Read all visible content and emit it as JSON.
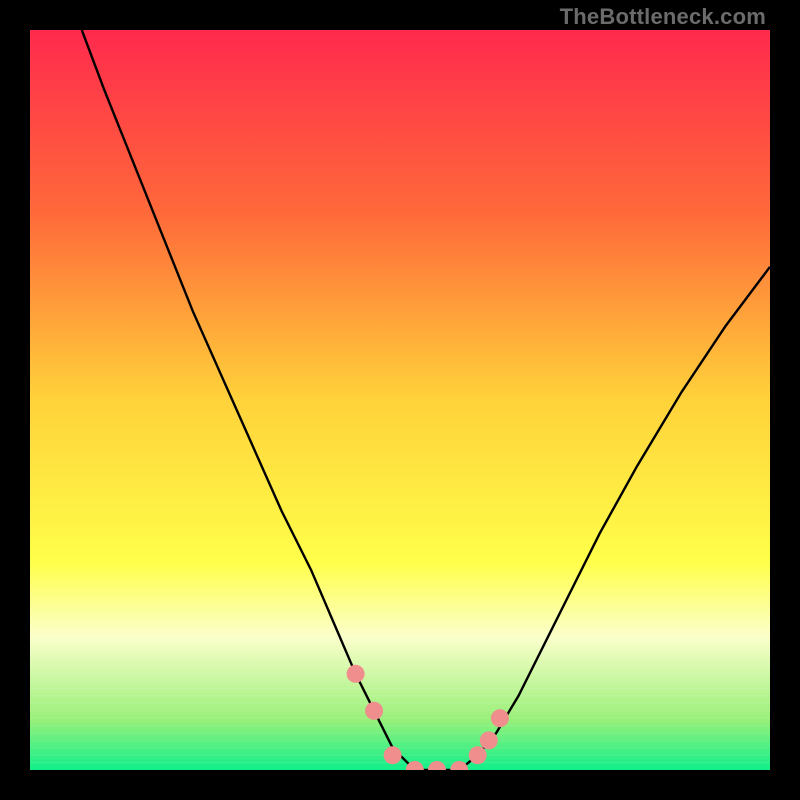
{
  "watermark": "TheBottleneck.com",
  "chart_data": {
    "type": "line",
    "title": "",
    "xlabel": "",
    "ylabel": "",
    "xlim": [
      0,
      100
    ],
    "ylim": [
      0,
      100
    ],
    "grid": false,
    "legend": false,
    "background_gradient": {
      "direction": "top-to-bottom",
      "stops": [
        {
          "pos": 0.0,
          "color": "#ff2a4d"
        },
        {
          "pos": 0.25,
          "color": "#ff6a3a"
        },
        {
          "pos": 0.5,
          "color": "#ffd23a"
        },
        {
          "pos": 0.72,
          "color": "#ffff4a"
        },
        {
          "pos": 0.82,
          "color": "#fbffcb"
        },
        {
          "pos": 0.93,
          "color": "#9bf07a"
        },
        {
          "pos": 1.0,
          "color": "#10ef8a"
        }
      ]
    },
    "series": [
      {
        "name": "bottleneck-curve",
        "type": "line",
        "color": "#000000",
        "x": [
          7,
          10,
          14,
          18,
          22,
          26,
          30,
          34,
          38,
          41,
          44,
          46.5,
          49,
          52,
          55,
          58,
          60.5,
          63,
          66,
          69,
          73,
          77,
          82,
          88,
          94,
          100
        ],
        "y": [
          100,
          92,
          82,
          72,
          62,
          53,
          44,
          35,
          27,
          20,
          13,
          8,
          3,
          0,
          0,
          0,
          2,
          5,
          10,
          16,
          24,
          32,
          41,
          51,
          60,
          68
        ]
      },
      {
        "name": "highlight-markers",
        "type": "scatter",
        "color": "#ef8e8d",
        "marker_size": 9,
        "x": [
          44,
          46.5,
          49,
          52,
          55,
          58,
          60.5,
          62,
          63.5
        ],
        "y": [
          13,
          8,
          2,
          0,
          0,
          0,
          2,
          4,
          7
        ]
      }
    ],
    "annotations": []
  }
}
